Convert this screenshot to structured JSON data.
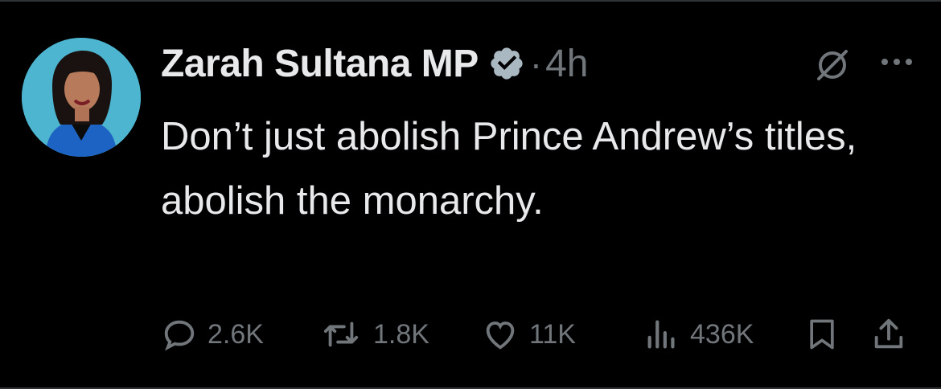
{
  "tweet": {
    "author_name": "Zarah Sultana MP",
    "separator": "·",
    "time": "4h",
    "text": "Don’t just abolish Prince Andrew’s titles, abolish the monarchy."
  },
  "icons": {
    "verified": "verified-badge-icon",
    "grok": "grok-icon",
    "more": "more-icon",
    "reply": "reply-icon",
    "retweet": "retweet-icon",
    "like": "like-icon",
    "views": "views-icon",
    "bookmark": "bookmark-icon",
    "share": "share-icon"
  },
  "actions": {
    "replies": "2.6K",
    "reposts": "1.8K",
    "likes": "11K",
    "views": "436K"
  },
  "colors": {
    "background": "#000000",
    "text": "#e7e9ea",
    "muted": "#71767b",
    "verified": "#aab8c2",
    "divider": "#2f3336"
  }
}
